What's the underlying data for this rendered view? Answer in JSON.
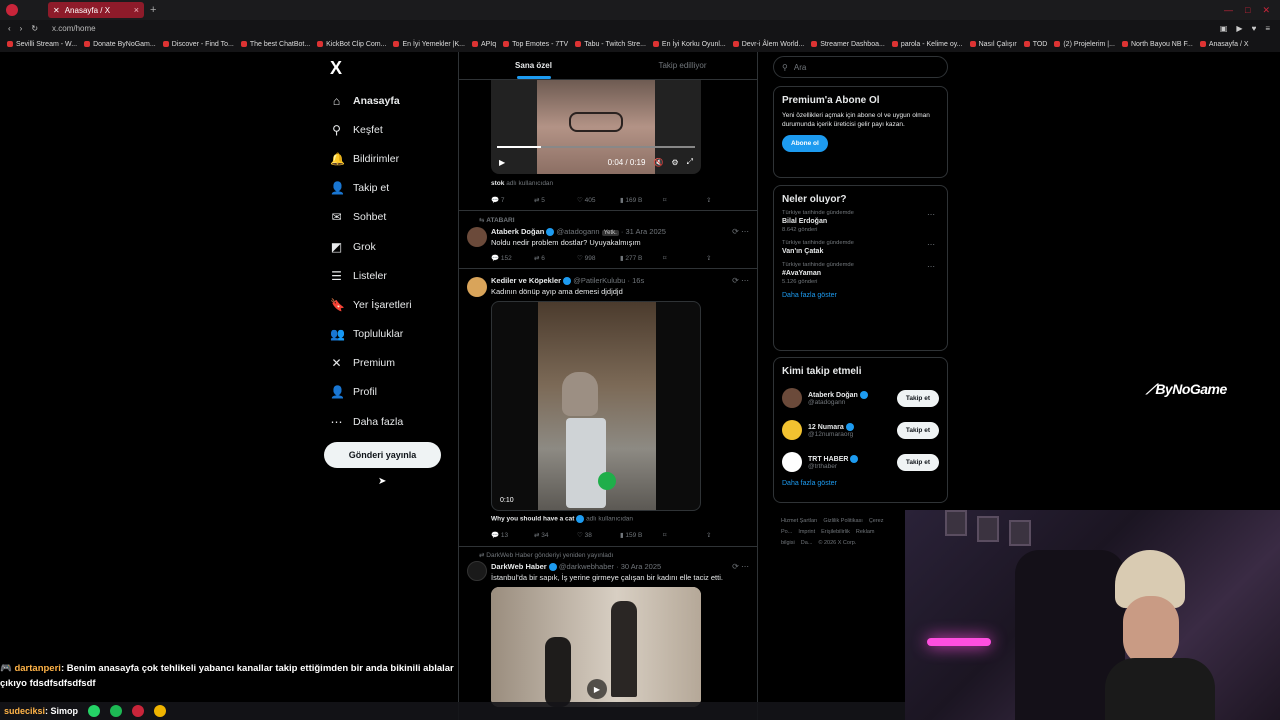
{
  "browser": {
    "tab_title": "Anasayfa / X",
    "url": "x.com/home",
    "bookmarks": [
      "Sevilli Stream - W...",
      "Donate ByNoGam...",
      "Discover - Find To...",
      "The best ChatBot...",
      "KickBot Clip Com...",
      "En İyi Yemekler |K...",
      "APIq",
      "Top Emotes - 7TV",
      "Tabu - Twitch Stre...",
      "En İyi Korku Oyunl...",
      "Devr-i Âlem World...",
      "Streamer Dashboa...",
      "parola - Kelime oy...",
      "Nasıl Çalışır",
      "TOD",
      "(2) Projelerim |...",
      "North Bayou NB F...",
      "Anasayfa / X"
    ]
  },
  "nav": {
    "logo": "X",
    "items": [
      {
        "label": "Anasayfa",
        "icon": "home-icon",
        "glyph": "⌂"
      },
      {
        "label": "Keşfet",
        "icon": "search-icon",
        "glyph": "⚲"
      },
      {
        "label": "Bildirimler",
        "icon": "bell-icon",
        "glyph": "🔔"
      },
      {
        "label": "Takip et",
        "icon": "follow-icon",
        "glyph": "👤"
      },
      {
        "label": "Sohbet",
        "icon": "mail-icon",
        "glyph": "✉"
      },
      {
        "label": "Grok",
        "icon": "grok-icon",
        "glyph": "◩"
      },
      {
        "label": "Listeler",
        "icon": "list-icon",
        "glyph": "☰"
      },
      {
        "label": "Yer İşaretleri",
        "icon": "bookmark-icon",
        "glyph": "🔖"
      },
      {
        "label": "Topluluklar",
        "icon": "communities-icon",
        "glyph": "👥"
      },
      {
        "label": "Premium",
        "icon": "x-icon",
        "glyph": "✕"
      },
      {
        "label": "Profil",
        "icon": "profile-icon",
        "glyph": "👤"
      },
      {
        "label": "Daha fazla",
        "icon": "more-icon",
        "glyph": "⋯"
      }
    ],
    "post_button": "Gönderi yayınla"
  },
  "timeline": {
    "tabs": [
      "Sana özel",
      "Takip edilliyor"
    ],
    "tweet1": {
      "video_time": "0:04 / 0:19",
      "caption_user": "stok",
      "caption_rest": "adlı kullanıcıdan",
      "replies": "7",
      "retweets": "5",
      "likes": "405",
      "views": "169 B"
    },
    "tweet2": {
      "context": "ATABARI",
      "name": "Ataberk Doğan",
      "handle": "@atadogann",
      "badge": "Yetk.",
      "date": "31 Ara 2025",
      "text": "Noldu nedir problem dostlar? Uyuyakalmışım",
      "replies": "152",
      "retweets": "6",
      "likes": "998",
      "views": "277 B"
    },
    "tweet3": {
      "name": "Kediler ve Köpekler",
      "handle": "@PatilerKulubu",
      "time": "16s",
      "text": "Kadının dönüp ayıp ama demesi djdjdjd",
      "video_duration": "0:10",
      "caption_user": "Why you should have a cat",
      "caption_rest": "adlı kullanıcıdan",
      "replies": "13",
      "retweets": "34",
      "likes": "38",
      "views": "159 B"
    },
    "tweet4": {
      "context": "DarkWeb Haber gönderiyi yeniden yayınladı",
      "name": "DarkWeb Haber",
      "handle": "@darkwebhaber",
      "date": "30 Ara 2025",
      "text": "İstanbul'da bir sapık, İş yerine girmeye çalışan bir kadını elle taciz etti."
    }
  },
  "sidebar": {
    "search_placeholder": "Ara",
    "premium": {
      "title": "Premium'a Abone Ol",
      "text": "Yeni özellikleri açmak için abone ol ve uygun olman durumunda içerik üreticisi gelir payı kazan.",
      "button": "Abone ol"
    },
    "trends": {
      "title": "Neler oluyor?",
      "items": [
        {
          "context": "Türkiye tarihinde gündemde",
          "name": "Bilal Erdoğan",
          "count": "8.642 gönderi"
        },
        {
          "context": "Türkiye tarihinde gündemde",
          "name": "Van'ın Çatak",
          "count": ""
        },
        {
          "context": "Türkiye tarihinde gündemde",
          "name": "#AvaYaman",
          "count": "5.126 gönderi"
        }
      ],
      "show_more": "Daha fazla göster"
    },
    "who_to_follow": {
      "title": "Kimi takip etmeli",
      "items": [
        {
          "name": "Ataberk Doğan",
          "handle": "@atadogann",
          "button": "Takip et",
          "color": "#6b4a3a"
        },
        {
          "name": "12 Numara",
          "handle": "@12numaraorg",
          "button": "Takip et",
          "color": "#f2c230"
        },
        {
          "name": "TRT HABER",
          "handle": "@trthaber",
          "button": "Takip et",
          "color": "#ffffff"
        }
      ],
      "show_more": "Daha fazla göster"
    },
    "footer": [
      "Hizmet Şartları",
      "Gizlilik Politikası",
      "Çerez Po...",
      "Imprint",
      "Erişilebilirlik",
      "Reklam bilgisi",
      "Da...",
      "© 2026 X Corp."
    ]
  },
  "overlay": {
    "brand": "ByNoGame",
    "chat_user": "dartanperi",
    "chat_text": ": Benim anasayfa çok tehlikeli yabancı kanallar takip ettiğimden bir anda bikinili ablalar çıkıyo fdsdfsdfsdfsdf",
    "taskbar_user": "sudeciksi",
    "taskbar_text": ": Simop"
  }
}
